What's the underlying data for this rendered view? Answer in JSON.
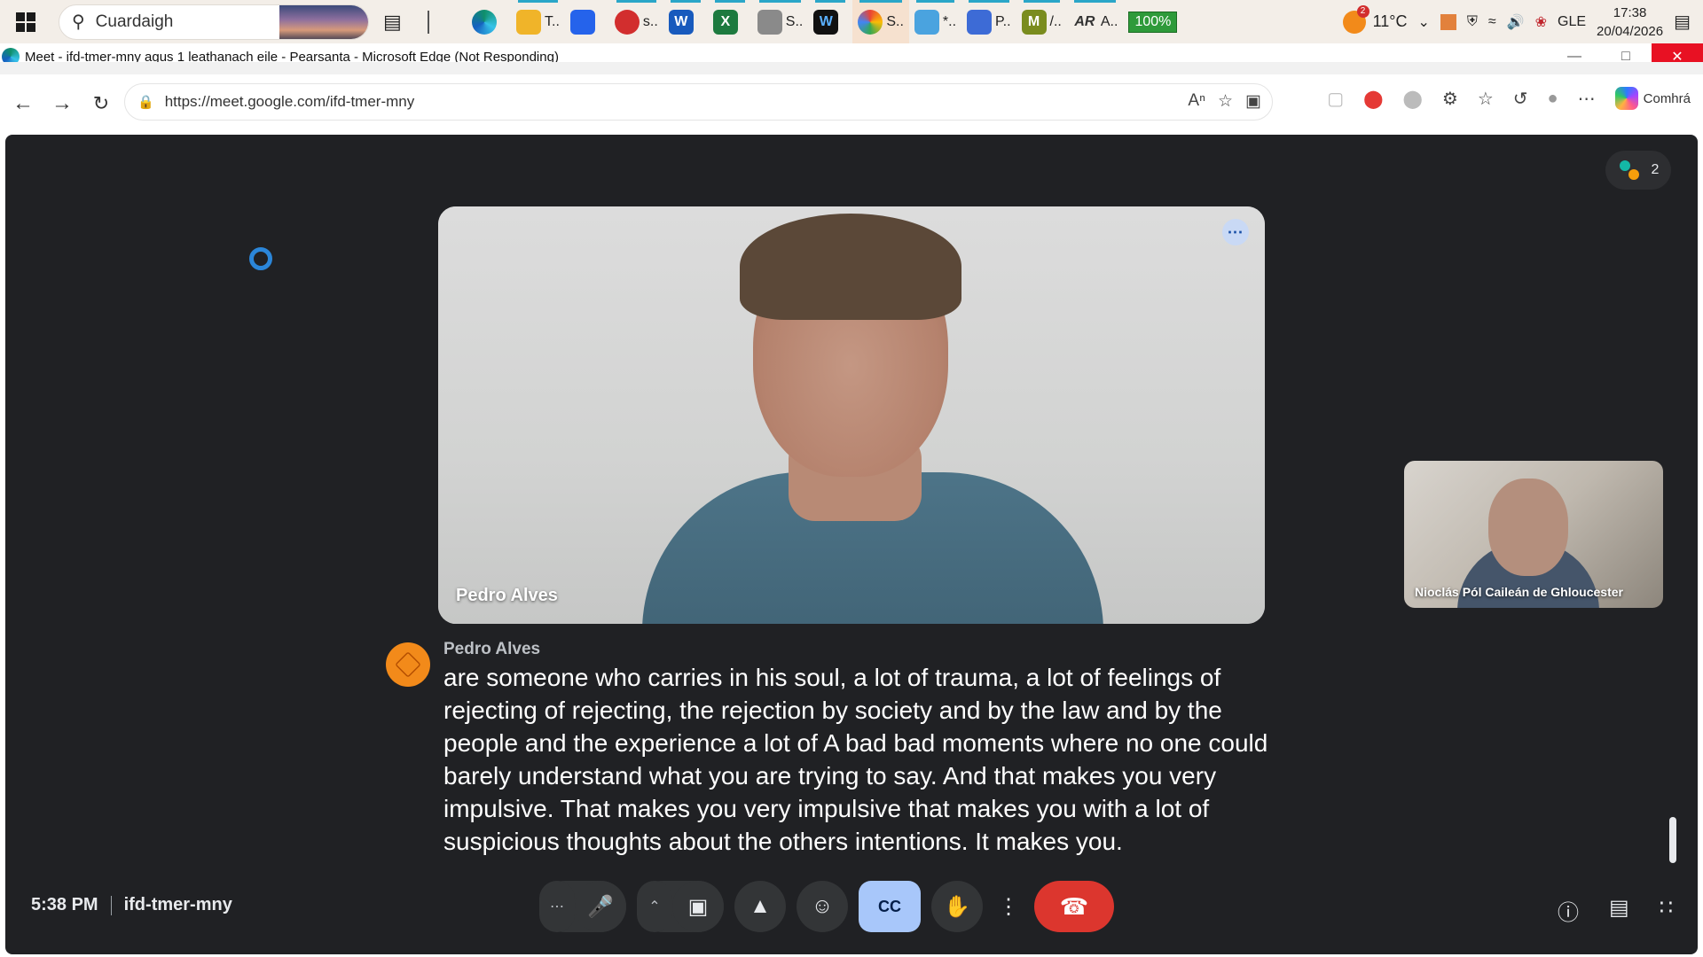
{
  "taskbar": {
    "search_label": "Cuardaigh",
    "apps": [
      {
        "label": "T..",
        "color": "#f0b429"
      },
      {
        "label": "",
        "color": "#2563eb"
      },
      {
        "label": "s..",
        "color": "#d22e2e"
      },
      {
        "label": "",
        "color": "#185abd"
      },
      {
        "label": "",
        "color": "#1d7a3f"
      },
      {
        "label": "S..",
        "color": "#8a8a8a"
      },
      {
        "label": "",
        "color": "#2563eb"
      },
      {
        "label": "S..",
        "color": "#ea4335"
      },
      {
        "label": "*..",
        "color": "#4aa3df"
      },
      {
        "label": "P..",
        "color": "#3d6bd6"
      },
      {
        "label": "/..",
        "color": "#7a8c1e"
      },
      {
        "label": "A..",
        "color": "#444444"
      }
    ],
    "battery_percent": "100%",
    "weather_temp": "11°C",
    "weather_badge": "2",
    "language": "GLE",
    "time": "17:38",
    "date": "20/04/2026"
  },
  "window": {
    "title": "Meet - ifd-tmer-mny agus 1 leathanach eile - Pearsanta - Microsoft Edge (Not Responding)"
  },
  "browser": {
    "url": "https://meet.google.com/ifd-tmer-mny",
    "copilot_label": "Comhrá"
  },
  "meet": {
    "participant_count": "2",
    "main_tile_name": "Pedro Alves",
    "self_tile_name": "Nioclás Pól Caileán de Ghloucester",
    "caption_speaker": "Pedro Alves",
    "caption_text": "are someone who carries in his soul, a lot of trauma, a lot of feelings of rejecting of rejecting, the rejection by society and by the law and by the people and the experience a lot of A bad bad moments where no one could barely understand what you are trying to say. And that makes you very impulsive. That makes you very impulsive that makes you with a lot of suspicious thoughts about the others intentions. It makes you.",
    "meeting_time": "5:38 PM",
    "meeting_code": "ifd-tmer-mny",
    "accent_blue": "#a8c7fa",
    "end_red": "#dc362e"
  }
}
